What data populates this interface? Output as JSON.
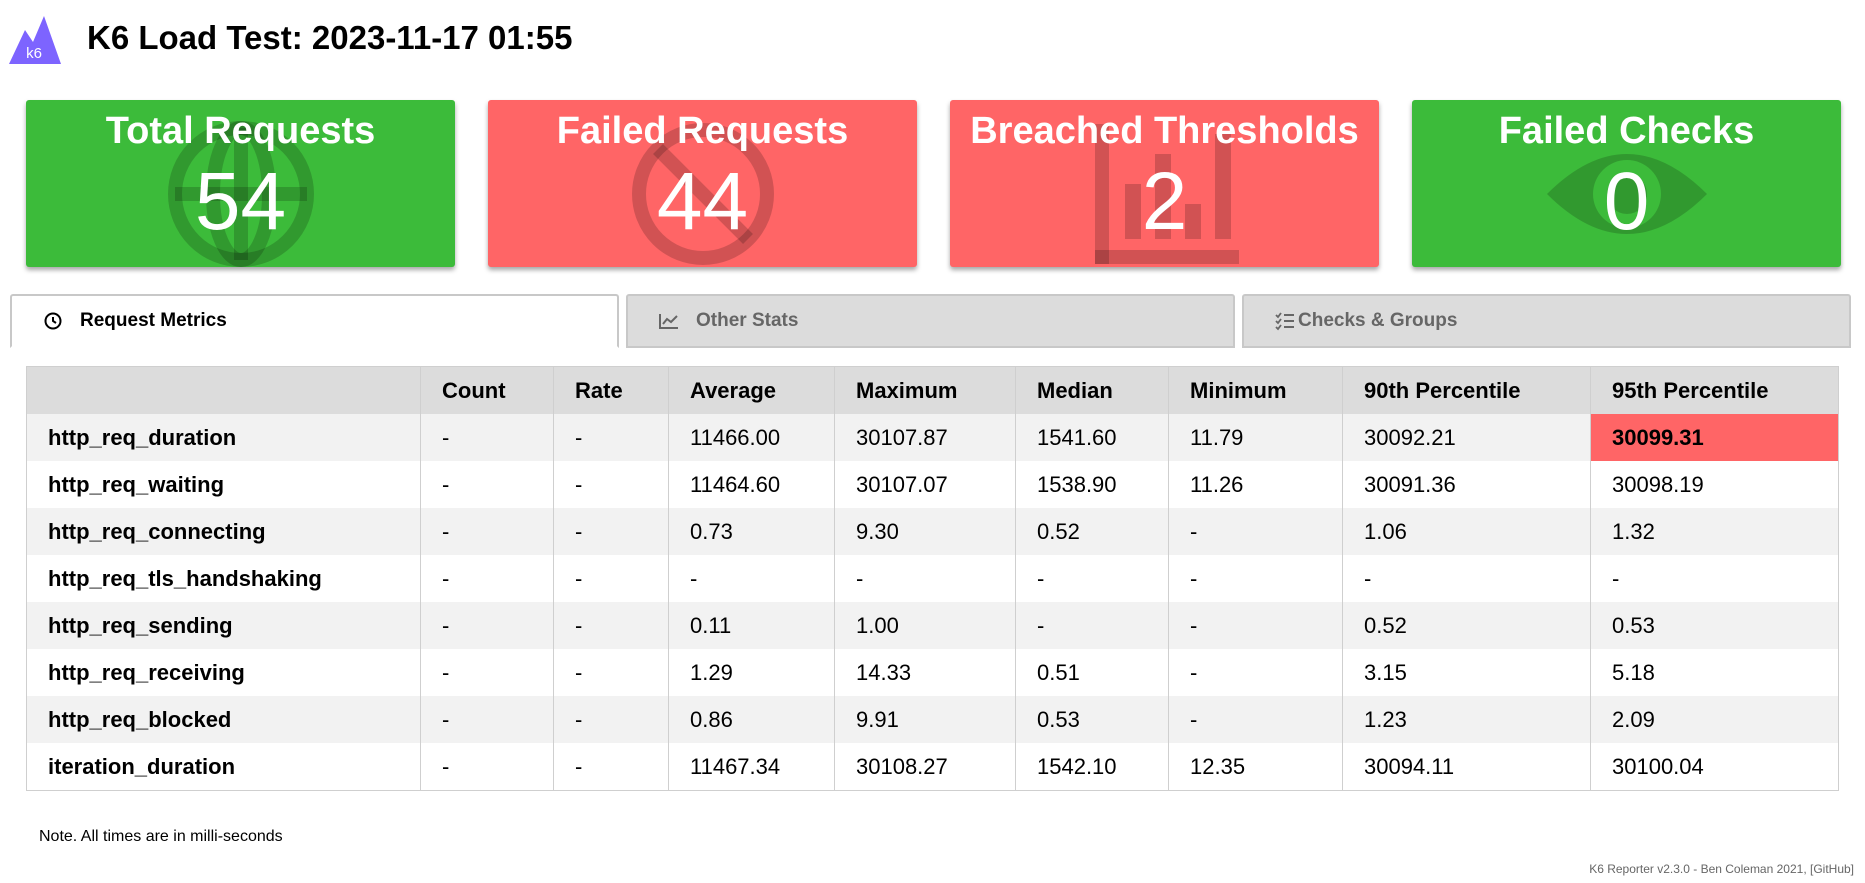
{
  "header": {
    "title": "K6 Load Test: 2023-11-17 01:55",
    "logo_text": "k6"
  },
  "cards": [
    {
      "title": "Total Requests",
      "value": "54",
      "status": "good",
      "icon": "globe-icon"
    },
    {
      "title": "Failed Requests",
      "value": "44",
      "status": "bad",
      "icon": "no-entry-icon"
    },
    {
      "title": "Breached Thresholds",
      "value": "2",
      "status": "bad",
      "icon": "bar-chart-icon"
    },
    {
      "title": "Failed Checks",
      "value": "0",
      "status": "good",
      "icon": "eye-icon"
    }
  ],
  "tabs": [
    {
      "label": "Request Metrics",
      "icon": "clock-icon",
      "active": true
    },
    {
      "label": "Other Stats",
      "icon": "line-chart-icon",
      "active": false
    },
    {
      "label": "Checks & Groups",
      "icon": "checklist-icon",
      "active": false
    }
  ],
  "table": {
    "headers": [
      "",
      "Count",
      "Rate",
      "Average",
      "Maximum",
      "Median",
      "Minimum",
      "90th Percentile",
      "95th Percentile"
    ],
    "rows": [
      {
        "name": "http_req_duration",
        "values": [
          "-",
          "-",
          "11466.00",
          "30107.87",
          "1541.60",
          "11.79",
          "30092.21",
          "30099.31"
        ],
        "breached_col": 7
      },
      {
        "name": "http_req_waiting",
        "values": [
          "-",
          "-",
          "11464.60",
          "30107.07",
          "1538.90",
          "11.26",
          "30091.36",
          "30098.19"
        ]
      },
      {
        "name": "http_req_connecting",
        "values": [
          "-",
          "-",
          "0.73",
          "9.30",
          "0.52",
          "-",
          "1.06",
          "1.32"
        ]
      },
      {
        "name": "http_req_tls_handshaking",
        "values": [
          "-",
          "-",
          "-",
          "-",
          "-",
          "-",
          "-",
          "-"
        ]
      },
      {
        "name": "http_req_sending",
        "values": [
          "-",
          "-",
          "0.11",
          "1.00",
          "-",
          "-",
          "0.52",
          "0.53"
        ]
      },
      {
        "name": "http_req_receiving",
        "values": [
          "-",
          "-",
          "1.29",
          "14.33",
          "0.51",
          "-",
          "3.15",
          "5.18"
        ]
      },
      {
        "name": "http_req_blocked",
        "values": [
          "-",
          "-",
          "0.86",
          "9.91",
          "0.53",
          "-",
          "1.23",
          "2.09"
        ]
      },
      {
        "name": "iteration_duration",
        "values": [
          "-",
          "-",
          "11467.34",
          "30108.27",
          "1542.10",
          "12.35",
          "30094.11",
          "30100.04"
        ]
      }
    ]
  },
  "note": "Note. All times are in milli-seconds",
  "footer": "K6 Reporter v2.3.0 - Ben Coleman 2021, [GitHub]",
  "colors": {
    "good": "#3cbb3a",
    "bad": "#ff6566",
    "logo": "#7d64ff"
  }
}
